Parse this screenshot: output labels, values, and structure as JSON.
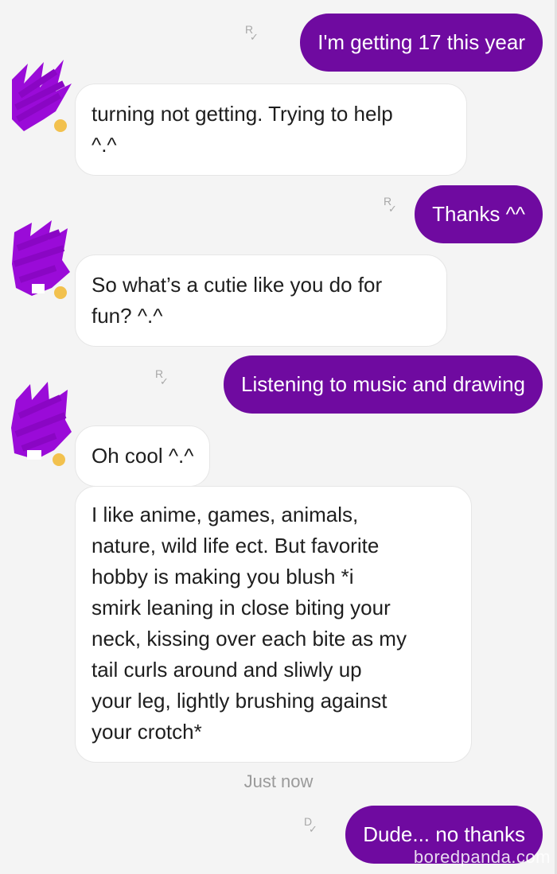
{
  "messages": [
    {
      "from": "me",
      "text": "I'm getting 17 this year",
      "receipt": "R"
    },
    {
      "from": "them",
      "text": "turning not getting. Trying to help\n^.^"
    },
    {
      "from": "me",
      "text": "Thanks ^^",
      "receipt": "R"
    },
    {
      "from": "them",
      "text": "So what’s a cutie like you do for\nfun? ^.^"
    },
    {
      "from": "me",
      "text": "Listening to music and drawing",
      "receipt": "R"
    },
    {
      "from": "them",
      "text": "Oh cool ^.^"
    },
    {
      "from": "them",
      "text": "I like anime, games, animals,\nnature, wild life ect. But favorite\nhobby is making you blush *i\nsmirk leaning in close biting your\nneck, kissing over each bite as my\ntail curls around and sliwly up\nyour leg, lightly brushing against\nyour crotch*"
    },
    {
      "from": "me",
      "text": "Dude... no thanks",
      "receipt": "D"
    }
  ],
  "timestamp": "Just now",
  "watermark": "boredpanda.com",
  "colors": {
    "outgoing_bubble": "#6f0aa0",
    "incoming_bubble": "#ffffff",
    "background": "#f4f4f4",
    "avatar_scribble": "#9a0bd8"
  },
  "icons": {
    "receipt": "read-receipt-icon",
    "avatar": "avatar-redacted-icon"
  }
}
